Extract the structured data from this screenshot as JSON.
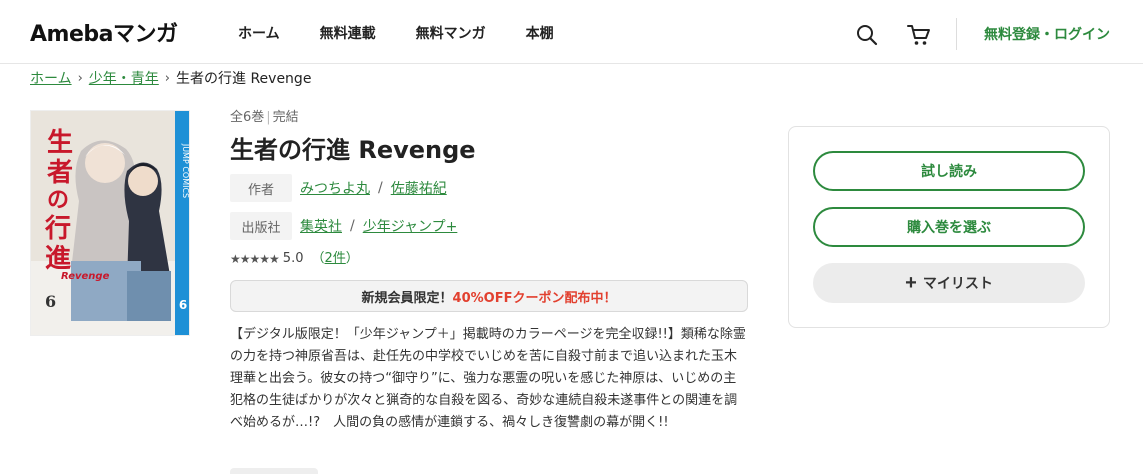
{
  "header": {
    "logo": "Amebaマンガ",
    "nav": [
      "ホーム",
      "無料連載",
      "無料マンガ",
      "本棚"
    ],
    "login": "無料登録・ログイン"
  },
  "breadcrumb": {
    "items": [
      "ホーム",
      "少年・青年"
    ],
    "current": "生者の行進 Revenge"
  },
  "cover": {
    "title_chars": [
      "生",
      "者",
      "の",
      "行",
      "進"
    ],
    "subtitle": "Revenge",
    "volume": "6",
    "side_label": "JUMP COMICS"
  },
  "book": {
    "volumes": "全6巻",
    "status": "完結",
    "title": "生者の行進 Revenge",
    "author_label": "作者",
    "authors": [
      "みつちよ丸",
      "佐藤祐紀"
    ],
    "publisher_label": "出版社",
    "publishers": [
      "集英社",
      "少年ジャンプ+"
    ],
    "stars": "★★★★★",
    "rating": "5.0",
    "review_count": "2件",
    "coupon_prefix": "新規会員限定！",
    "coupon_highlight": "40%OFFクーポン配布中！",
    "description": "【デジタル版限定！「少年ジャンプ＋」掲載時のカラーページを完全収録!!】類稀な除霊の力を持つ神原省吾は、赴任先の中学校でいじめを苦に自殺寸前まで追い込まれた玉木理華と出会う。彼女の持つ“御守り”に、強力な悪霊の呪いを感じた神原は、いじめの主犯格の生徒ばかりが次々と猟奇的な自殺を図る、奇妙な連続自殺未遂事件との関連を調べ始めるが…!?　人間の負の感情が連鎖する、禍々しき復讐劇の幕が開く!!"
  },
  "actions": {
    "trial": "試し読み",
    "buy": "購入巻を選ぶ",
    "mylist": "マイリスト"
  },
  "colors": {
    "accent": "#2d8a3e",
    "coupon_red": "#e2402f"
  }
}
